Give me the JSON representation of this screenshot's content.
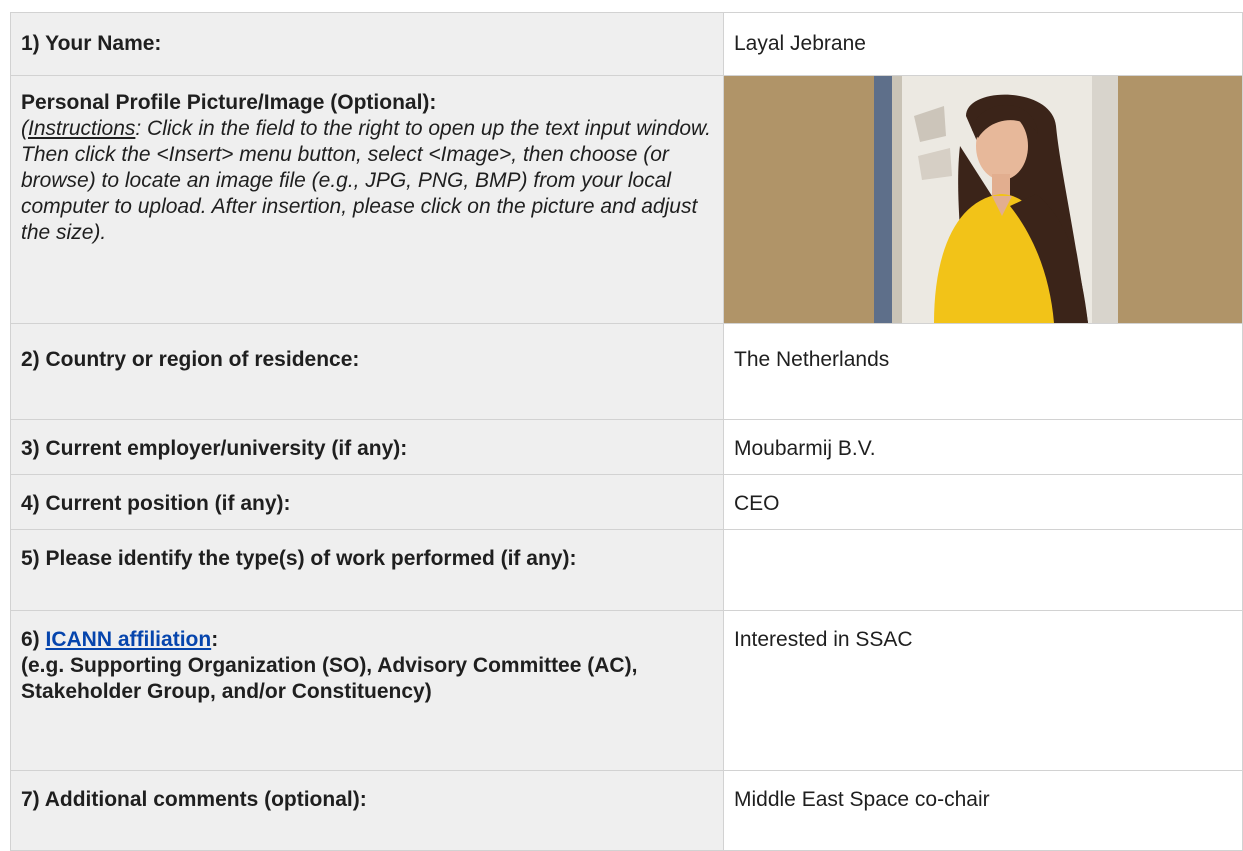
{
  "rows": {
    "name": {
      "label": "1) Your Name:",
      "value": "Layal Jebrane"
    },
    "photo": {
      "label": "Personal Profile Picture/Image (Optional):",
      "instructions_open": "(",
      "instructions_word": "Instructions",
      "instructions_text": ": Click in the field to the right to open up the text input window. Then click the <Insert> menu button, select <Image>, then choose (or browse) to locate an image file (e.g., JPG, PNG, BMP) from your local computer to upload. After insertion, please click on the picture and adjust the size)."
    },
    "country": {
      "label": "2) Country or region of residence:",
      "value": "The Netherlands"
    },
    "employer": {
      "label": "3) Current employer/university (if any):",
      "value": "Moubarmij B.V."
    },
    "position": {
      "label": "4) Current position (if any):",
      "value": "CEO"
    },
    "work": {
      "label": "5) Please identify the type(s) of work performed (if any):",
      "value": ""
    },
    "affiliation": {
      "label_prefix": "6) ",
      "link_text": "ICANN affiliation",
      "label_suffix": ":",
      "label_detail": "(e.g. Supporting Organization (SO), Advisory Committee (AC), Stakeholder Group, and/or Constituency)",
      "value": "Interested in SSAC"
    },
    "comments": {
      "label": "7) Additional comments (optional):",
      "value": "Middle East Space co-chair"
    }
  },
  "colors": {
    "label_bg": "#efefef",
    "border": "#d2d2d2",
    "link": "#0645ad",
    "photo_bg": "#b09468"
  }
}
